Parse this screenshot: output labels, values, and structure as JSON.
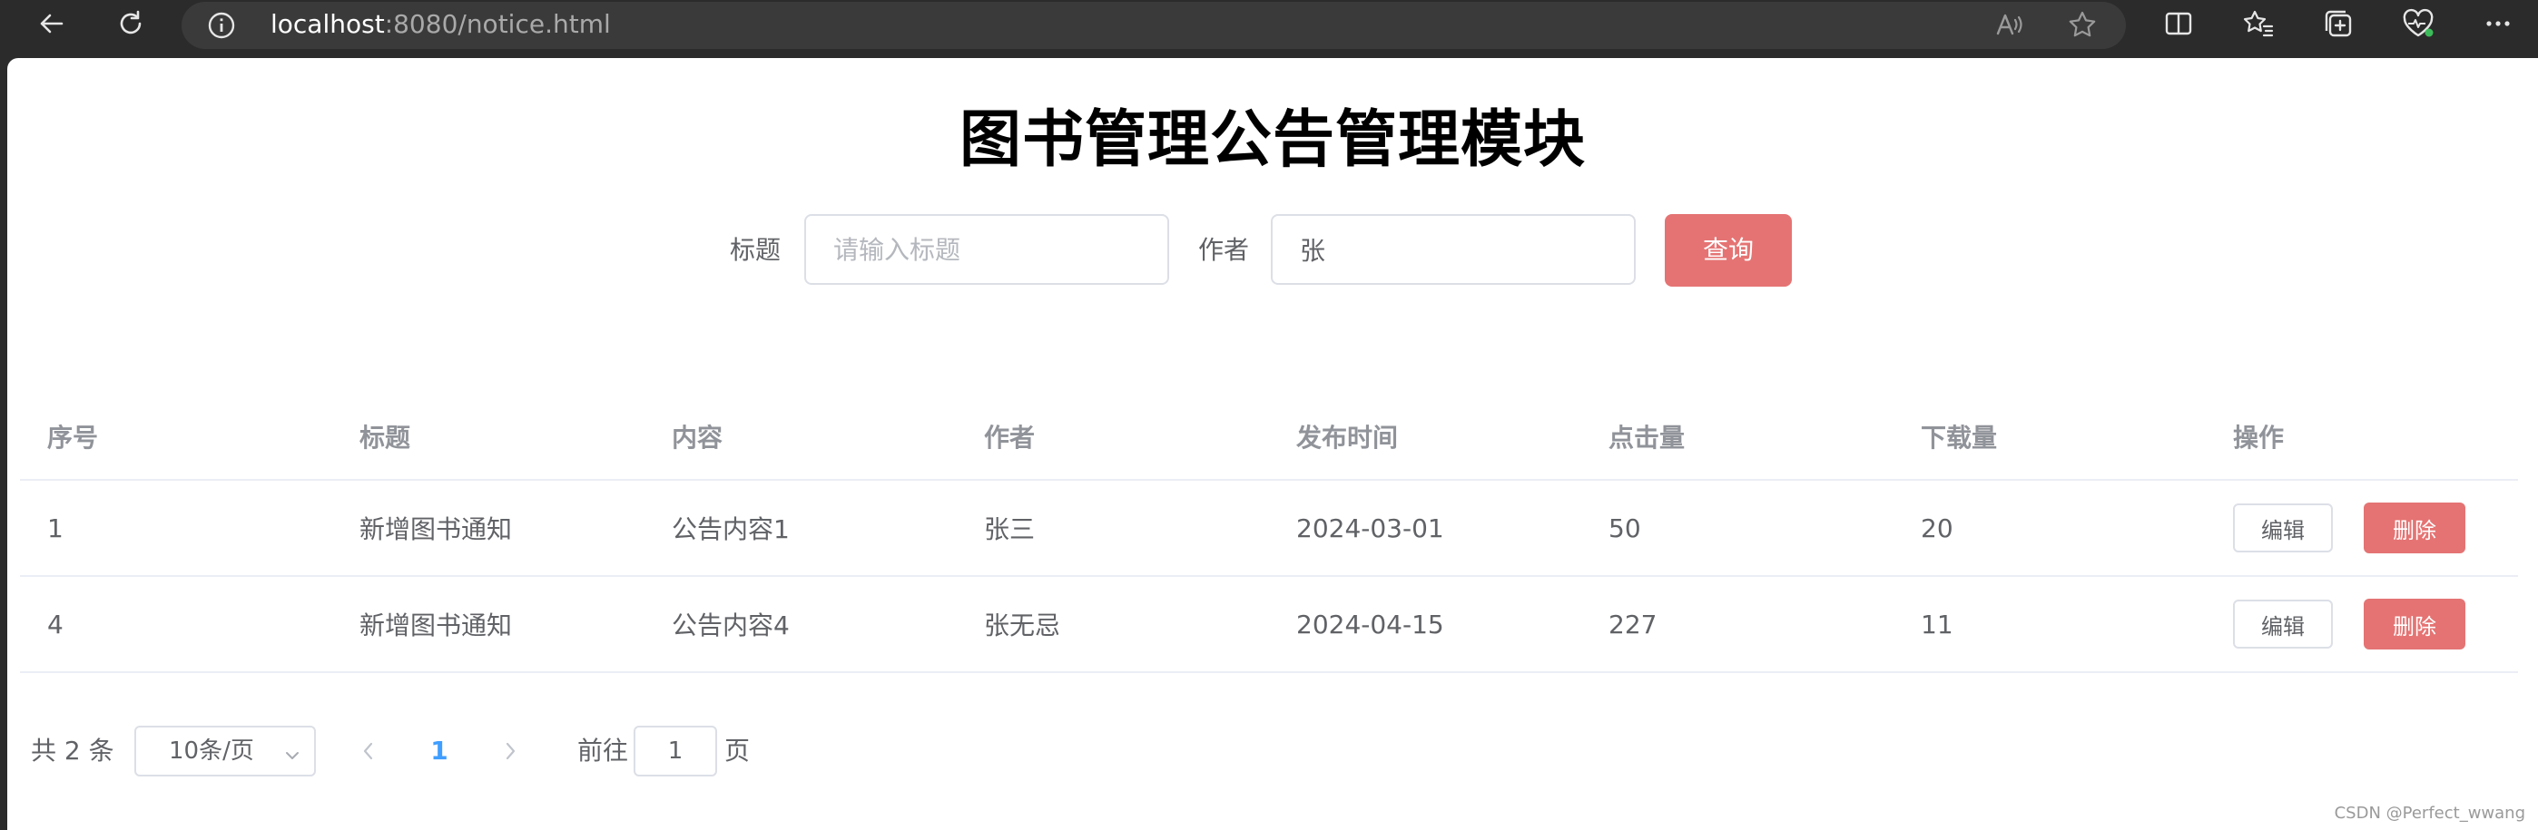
{
  "browser": {
    "url_host": "localhost",
    "url_rest": ":8080/notice.html"
  },
  "page": {
    "title": "图书管理公告管理模块"
  },
  "search": {
    "title_label": "标题",
    "title_placeholder": "请输入标题",
    "title_value": "",
    "author_label": "作者",
    "author_value": "张",
    "query_label": "查询"
  },
  "table": {
    "headers": [
      "序号",
      "标题",
      "内容",
      "作者",
      "发布时间",
      "点击量",
      "下载量",
      "操作"
    ],
    "rows": [
      {
        "id": "1",
        "title": "新增图书通知",
        "content": "公告内容1",
        "author": "张三",
        "date": "2024-03-01",
        "clicks": "50",
        "downloads": "20"
      },
      {
        "id": "4",
        "title": "新增图书通知",
        "content": "公告内容4",
        "author": "张无忌",
        "date": "2024-04-15",
        "clicks": "227",
        "downloads": "11"
      }
    ],
    "edit_label": "编辑",
    "delete_label": "删除"
  },
  "pagination": {
    "total_text": "共 2 条",
    "page_size": "10条/页",
    "current_page": "1",
    "goto_prefix": "前往",
    "goto_value": "1",
    "goto_suffix": "页"
  },
  "watermark": "CSDN @Perfect_wwang",
  "colors": {
    "accent_red": "#e57373",
    "active_blue": "#409eff"
  }
}
